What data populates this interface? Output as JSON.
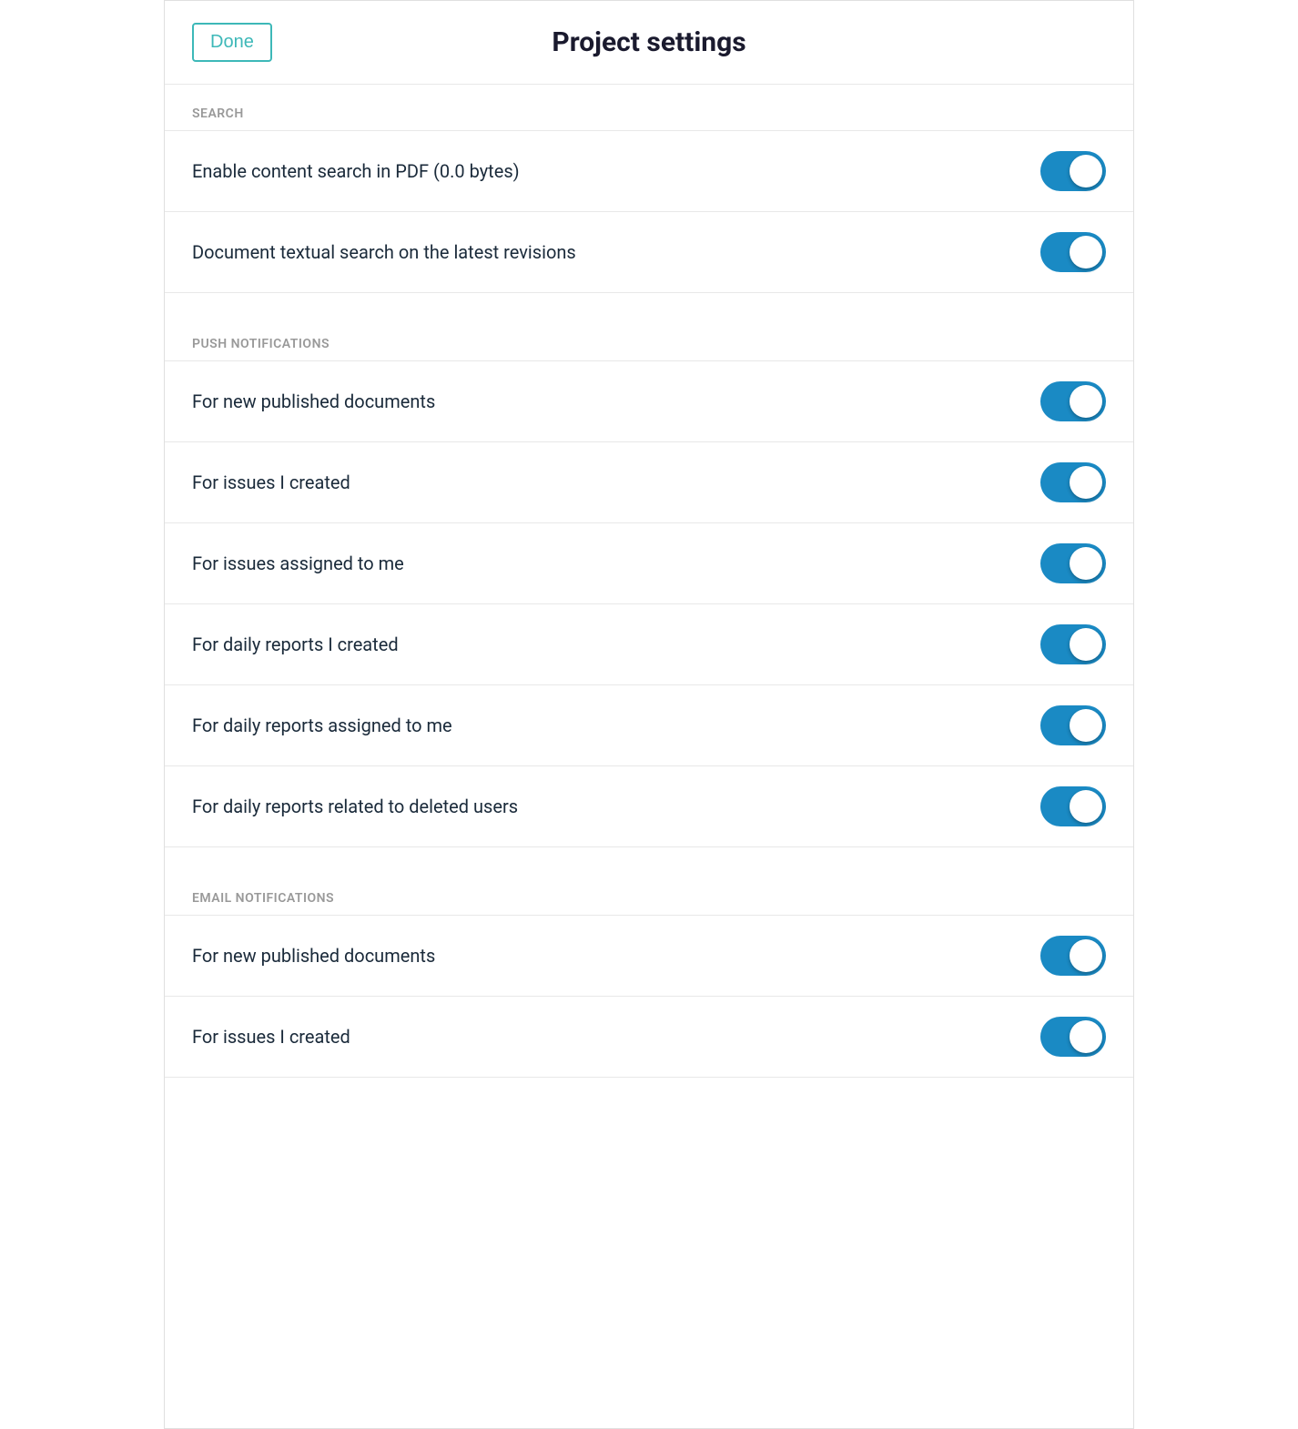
{
  "header": {
    "done_label": "Done",
    "title": "Project settings"
  },
  "sections": [
    {
      "id": "search",
      "label": "SEARCH",
      "settings": [
        {
          "id": "enable-content-search",
          "label": "Enable content search in PDF (0.0 bytes)",
          "enabled": true
        },
        {
          "id": "document-textual-search",
          "label": "Document textual search on the latest revisions",
          "enabled": true
        }
      ]
    },
    {
      "id": "push-notifications",
      "label": "PUSH NOTIFICATIONS",
      "settings": [
        {
          "id": "push-new-published",
          "label": "For new published documents",
          "enabled": true
        },
        {
          "id": "push-issues-created",
          "label": "For issues I created",
          "enabled": true
        },
        {
          "id": "push-issues-assigned",
          "label": "For issues assigned to me",
          "enabled": true
        },
        {
          "id": "push-daily-reports-created",
          "label": "For daily reports I created",
          "enabled": true
        },
        {
          "id": "push-daily-reports-assigned",
          "label": "For daily reports assigned to me",
          "enabled": true
        },
        {
          "id": "push-daily-reports-deleted",
          "label": "For daily reports related to deleted users",
          "enabled": true
        }
      ]
    },
    {
      "id": "email-notifications",
      "label": "EMAIL NOTIFICATIONS",
      "settings": [
        {
          "id": "email-new-published",
          "label": "For new published documents",
          "enabled": true
        },
        {
          "id": "email-issues-created",
          "label": "For issues I created",
          "enabled": true
        }
      ]
    }
  ]
}
